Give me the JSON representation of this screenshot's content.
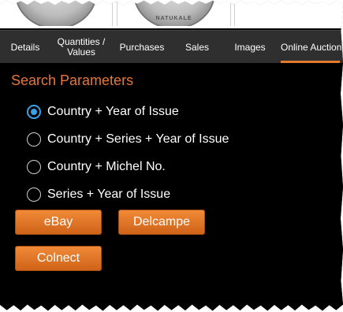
{
  "header_images": {
    "coin_b_text": "NATUKALE"
  },
  "tabs": [
    {
      "label": "Details",
      "active": false
    },
    {
      "label": "Quantities /\nValues",
      "active": false
    },
    {
      "label": "Purchases",
      "active": false
    },
    {
      "label": "Sales",
      "active": false
    },
    {
      "label": "Images",
      "active": false
    },
    {
      "label": "Online Auction",
      "active": true
    }
  ],
  "search": {
    "title": "Search Parameters",
    "options": [
      {
        "label": "Country + Year of Issue",
        "checked": true
      },
      {
        "label": "Country + Series + Year of Issue",
        "checked": false
      },
      {
        "label": "Country + Michel No.",
        "checked": false
      },
      {
        "label": "Series + Year of Issue",
        "checked": false
      }
    ]
  },
  "buttons": {
    "ebay": "eBay",
    "delcampe": "Delcampe",
    "colnect": "Colnect"
  },
  "colors": {
    "accent": "#e07a2e",
    "title": "#e8753a",
    "radio_selected": "#3aa3e8",
    "tab_bar": "#2f2f2f",
    "background": "#000000"
  }
}
